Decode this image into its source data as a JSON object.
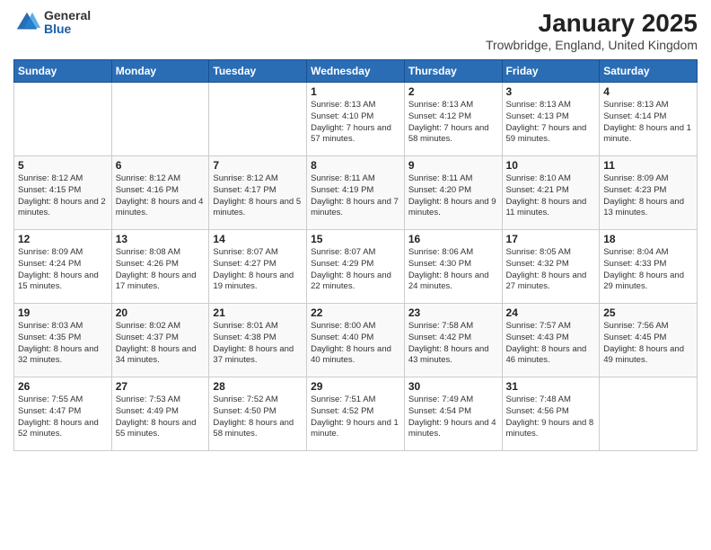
{
  "logo": {
    "general": "General",
    "blue": "Blue"
  },
  "title": "January 2025",
  "subtitle": "Trowbridge, England, United Kingdom",
  "weekdays": [
    "Sunday",
    "Monday",
    "Tuesday",
    "Wednesday",
    "Thursday",
    "Friday",
    "Saturday"
  ],
  "weeks": [
    [
      {
        "day": "",
        "info": ""
      },
      {
        "day": "",
        "info": ""
      },
      {
        "day": "",
        "info": ""
      },
      {
        "day": "1",
        "info": "Sunrise: 8:13 AM\nSunset: 4:10 PM\nDaylight: 7 hours and 57 minutes."
      },
      {
        "day": "2",
        "info": "Sunrise: 8:13 AM\nSunset: 4:12 PM\nDaylight: 7 hours and 58 minutes."
      },
      {
        "day": "3",
        "info": "Sunrise: 8:13 AM\nSunset: 4:13 PM\nDaylight: 7 hours and 59 minutes."
      },
      {
        "day": "4",
        "info": "Sunrise: 8:13 AM\nSunset: 4:14 PM\nDaylight: 8 hours and 1 minute."
      }
    ],
    [
      {
        "day": "5",
        "info": "Sunrise: 8:12 AM\nSunset: 4:15 PM\nDaylight: 8 hours and 2 minutes."
      },
      {
        "day": "6",
        "info": "Sunrise: 8:12 AM\nSunset: 4:16 PM\nDaylight: 8 hours and 4 minutes."
      },
      {
        "day": "7",
        "info": "Sunrise: 8:12 AM\nSunset: 4:17 PM\nDaylight: 8 hours and 5 minutes."
      },
      {
        "day": "8",
        "info": "Sunrise: 8:11 AM\nSunset: 4:19 PM\nDaylight: 8 hours and 7 minutes."
      },
      {
        "day": "9",
        "info": "Sunrise: 8:11 AM\nSunset: 4:20 PM\nDaylight: 8 hours and 9 minutes."
      },
      {
        "day": "10",
        "info": "Sunrise: 8:10 AM\nSunset: 4:21 PM\nDaylight: 8 hours and 11 minutes."
      },
      {
        "day": "11",
        "info": "Sunrise: 8:09 AM\nSunset: 4:23 PM\nDaylight: 8 hours and 13 minutes."
      }
    ],
    [
      {
        "day": "12",
        "info": "Sunrise: 8:09 AM\nSunset: 4:24 PM\nDaylight: 8 hours and 15 minutes."
      },
      {
        "day": "13",
        "info": "Sunrise: 8:08 AM\nSunset: 4:26 PM\nDaylight: 8 hours and 17 minutes."
      },
      {
        "day": "14",
        "info": "Sunrise: 8:07 AM\nSunset: 4:27 PM\nDaylight: 8 hours and 19 minutes."
      },
      {
        "day": "15",
        "info": "Sunrise: 8:07 AM\nSunset: 4:29 PM\nDaylight: 8 hours and 22 minutes."
      },
      {
        "day": "16",
        "info": "Sunrise: 8:06 AM\nSunset: 4:30 PM\nDaylight: 8 hours and 24 minutes."
      },
      {
        "day": "17",
        "info": "Sunrise: 8:05 AM\nSunset: 4:32 PM\nDaylight: 8 hours and 27 minutes."
      },
      {
        "day": "18",
        "info": "Sunrise: 8:04 AM\nSunset: 4:33 PM\nDaylight: 8 hours and 29 minutes."
      }
    ],
    [
      {
        "day": "19",
        "info": "Sunrise: 8:03 AM\nSunset: 4:35 PM\nDaylight: 8 hours and 32 minutes."
      },
      {
        "day": "20",
        "info": "Sunrise: 8:02 AM\nSunset: 4:37 PM\nDaylight: 8 hours and 34 minutes."
      },
      {
        "day": "21",
        "info": "Sunrise: 8:01 AM\nSunset: 4:38 PM\nDaylight: 8 hours and 37 minutes."
      },
      {
        "day": "22",
        "info": "Sunrise: 8:00 AM\nSunset: 4:40 PM\nDaylight: 8 hours and 40 minutes."
      },
      {
        "day": "23",
        "info": "Sunrise: 7:58 AM\nSunset: 4:42 PM\nDaylight: 8 hours and 43 minutes."
      },
      {
        "day": "24",
        "info": "Sunrise: 7:57 AM\nSunset: 4:43 PM\nDaylight: 8 hours and 46 minutes."
      },
      {
        "day": "25",
        "info": "Sunrise: 7:56 AM\nSunset: 4:45 PM\nDaylight: 8 hours and 49 minutes."
      }
    ],
    [
      {
        "day": "26",
        "info": "Sunrise: 7:55 AM\nSunset: 4:47 PM\nDaylight: 8 hours and 52 minutes."
      },
      {
        "day": "27",
        "info": "Sunrise: 7:53 AM\nSunset: 4:49 PM\nDaylight: 8 hours and 55 minutes."
      },
      {
        "day": "28",
        "info": "Sunrise: 7:52 AM\nSunset: 4:50 PM\nDaylight: 8 hours and 58 minutes."
      },
      {
        "day": "29",
        "info": "Sunrise: 7:51 AM\nSunset: 4:52 PM\nDaylight: 9 hours and 1 minute."
      },
      {
        "day": "30",
        "info": "Sunrise: 7:49 AM\nSunset: 4:54 PM\nDaylight: 9 hours and 4 minutes."
      },
      {
        "day": "31",
        "info": "Sunrise: 7:48 AM\nSunset: 4:56 PM\nDaylight: 9 hours and 8 minutes."
      },
      {
        "day": "",
        "info": ""
      }
    ]
  ]
}
